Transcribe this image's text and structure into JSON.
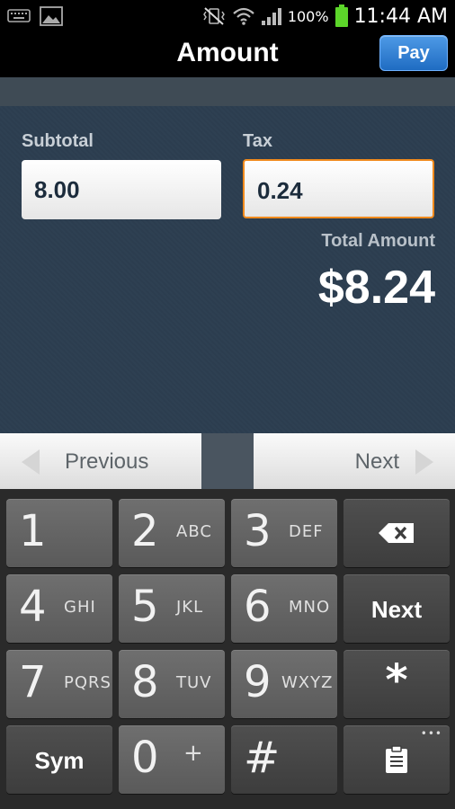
{
  "status_bar": {
    "battery": "100%",
    "time": "11:44 AM"
  },
  "header": {
    "title": "Amount",
    "pay_label": "Pay"
  },
  "form": {
    "subtotal_label": "Subtotal",
    "subtotal_value": "8.00",
    "tax_label": "Tax",
    "tax_value": "0.24",
    "total_label": "Total Amount",
    "total_value": "$8.24"
  },
  "nav": {
    "previous_label": "Previous",
    "next_label": "Next"
  },
  "keypad": {
    "keys": [
      {
        "digit": "1",
        "letters": ""
      },
      {
        "digit": "2",
        "letters": "ABC"
      },
      {
        "digit": "3",
        "letters": "DEF"
      },
      {
        "digit": "4",
        "letters": "GHI"
      },
      {
        "digit": "5",
        "letters": "JKL"
      },
      {
        "digit": "6",
        "letters": "MNO"
      },
      {
        "digit": "7",
        "letters": "PQRS"
      },
      {
        "digit": "8",
        "letters": "TUV"
      },
      {
        "digit": "9",
        "letters": "WXYZ"
      },
      {
        "digit": "0",
        "letters": "+"
      }
    ],
    "next_label": "Next",
    "star_label": "*",
    "sym_label": "Sym",
    "hash_label": "#"
  }
}
